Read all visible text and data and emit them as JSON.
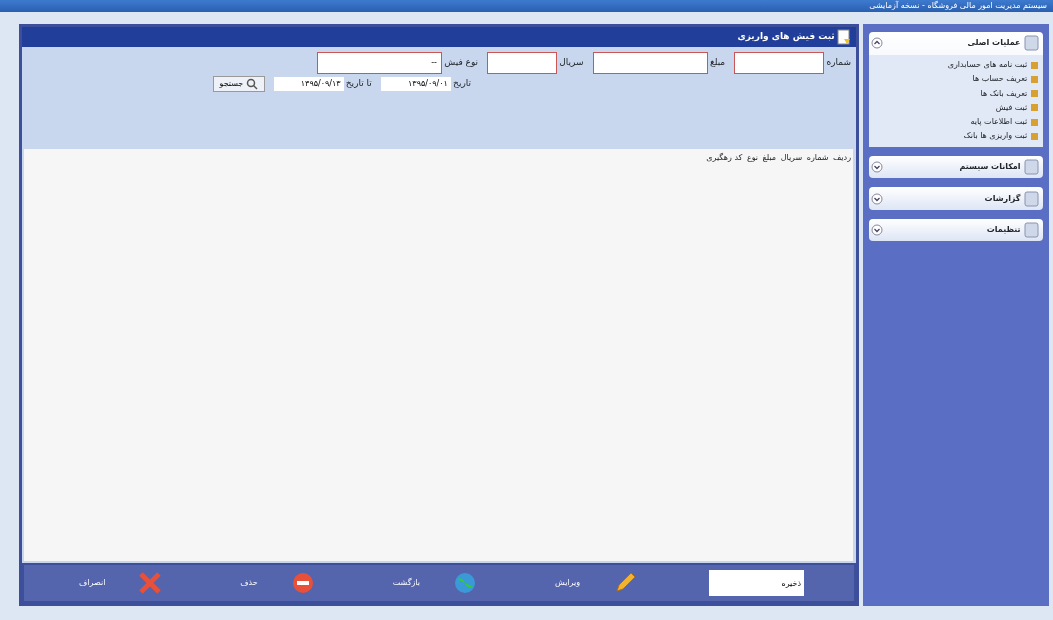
{
  "window": {
    "title": "سیستم مدیریت امور مالی فروشگاه - نسخه آزمایشی"
  },
  "form": {
    "title": "ثبت فیش های واریزی",
    "fields": [
      {
        "label": "شماره"
      },
      {
        "label": "مبلغ"
      },
      {
        "label": "سریال"
      },
      {
        "label": "نوع فیش",
        "value": "--"
      }
    ],
    "dates": [
      {
        "label": "تاریخ",
        "value": "۱۳۹۵/۰۹/۰۱"
      },
      {
        "label": "تا تاریخ",
        "value": "۱۳۹۵/۰۹/۱۳"
      }
    ],
    "search_button": "جستجو"
  },
  "table": {
    "columns": [
      "ردیف",
      "شماره",
      "سریال",
      "مبلغ",
      "نوع",
      "کد رهگیری"
    ]
  },
  "toolbar": {
    "field": {
      "value": "ذخیره"
    },
    "buttons": [
      {
        "kind": "edit",
        "label": "ویرایش"
      },
      {
        "kind": "refresh",
        "label": "بازگشت"
      },
      {
        "kind": "delete",
        "label": "حذف"
      },
      {
        "kind": "cancel",
        "label": "انصراف"
      }
    ]
  },
  "sidebar": {
    "groups": [
      {
        "title": "عملیات اصلی",
        "expanded": true,
        "items": [
          "ثبت نامه های حسابداری",
          "تعریف حساب ها",
          "تعریف بانک ها",
          "ثبت فیش",
          "ثبت اطلاعات پایه",
          "ثبت واریزی ها بانک"
        ]
      },
      {
        "title": "امکانات سیستم",
        "expanded": false
      },
      {
        "title": "گزارشات",
        "expanded": false
      },
      {
        "title": "تنظیمات",
        "expanded": false
      }
    ]
  }
}
